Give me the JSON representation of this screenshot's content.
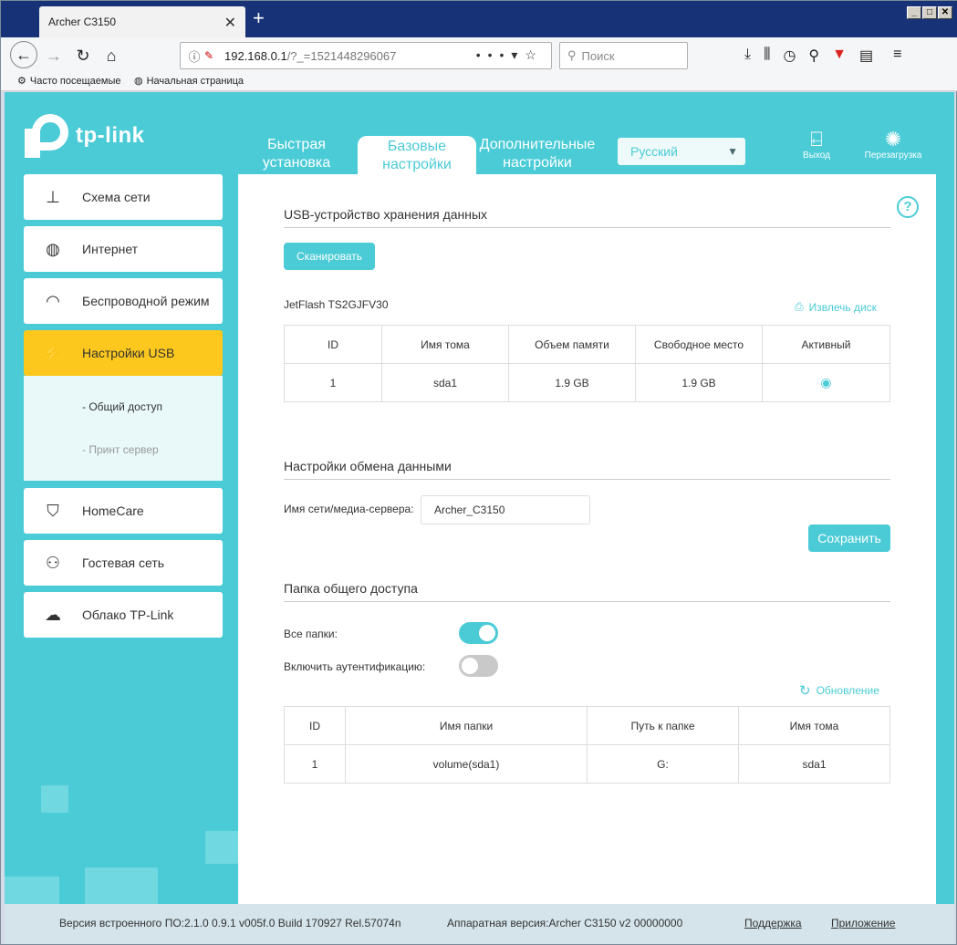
{
  "browser": {
    "tab_title": "Archer C3150",
    "url_host": "192.168.0.1",
    "url_rest": "/?_=1521448296067",
    "search_placeholder": "Поиск",
    "bookmarks": [
      "Часто посещаемые",
      "Начальная страница"
    ]
  },
  "header": {
    "logo": "tp-link",
    "tabs": [
      {
        "label": "Быстрая установка"
      },
      {
        "label": "Базовые настройки"
      },
      {
        "label": "Дополнительные настройки"
      }
    ],
    "language": "Русский",
    "logout": "Выход",
    "reboot": "Перезагрузка"
  },
  "sidebar": {
    "items": [
      {
        "label": "Схема сети"
      },
      {
        "label": "Интернет"
      },
      {
        "label": "Беспроводной режим"
      },
      {
        "label": "Настройки USB"
      },
      {
        "label": "HomeCare"
      },
      {
        "label": "Гостевая сеть"
      },
      {
        "label": "Облако TP-Link"
      }
    ],
    "sub": [
      "- Общий доступ",
      "- Принт сервер"
    ]
  },
  "usb": {
    "title": "USB-устройство хранения данных",
    "scan": "Сканировать",
    "device": "JetFlash  TS2GJFV30",
    "eject": "Извлечь диск",
    "headers": [
      "ID",
      "Имя тома",
      "Объем памяти",
      "Свободное место",
      "Активный"
    ],
    "row": [
      "1",
      "sda1",
      "1.9 GB",
      "1.9 GB"
    ]
  },
  "exchange": {
    "title": "Настройки обмена данными",
    "label": "Имя сети/медиа-сервера:",
    "value": "Archer_C3150",
    "save": "Сохранить"
  },
  "shared": {
    "title": "Папка общего доступа",
    "all_folders": "Все папки:",
    "auth": "Включить аутентификацию:",
    "all_folders_on": true,
    "auth_on": false,
    "refresh": "Обновление",
    "headers": [
      "ID",
      "Имя папки",
      "Путь к папке",
      "Имя тома"
    ],
    "row": [
      "1",
      "volume(sda1)",
      "G:",
      "sda1"
    ]
  },
  "footer": {
    "firmware": "Версия встроенного ПО:2.1.0 0.9.1 v005f.0 Build 170927 Rel.57074n",
    "hardware": "Аппаратная версия:Archer C3150 v2 00000000",
    "support": "Поддержка",
    "app": "Приложение"
  },
  "colors": {
    "accent": "#4acbd6",
    "active_menu": "#fdc81e"
  }
}
